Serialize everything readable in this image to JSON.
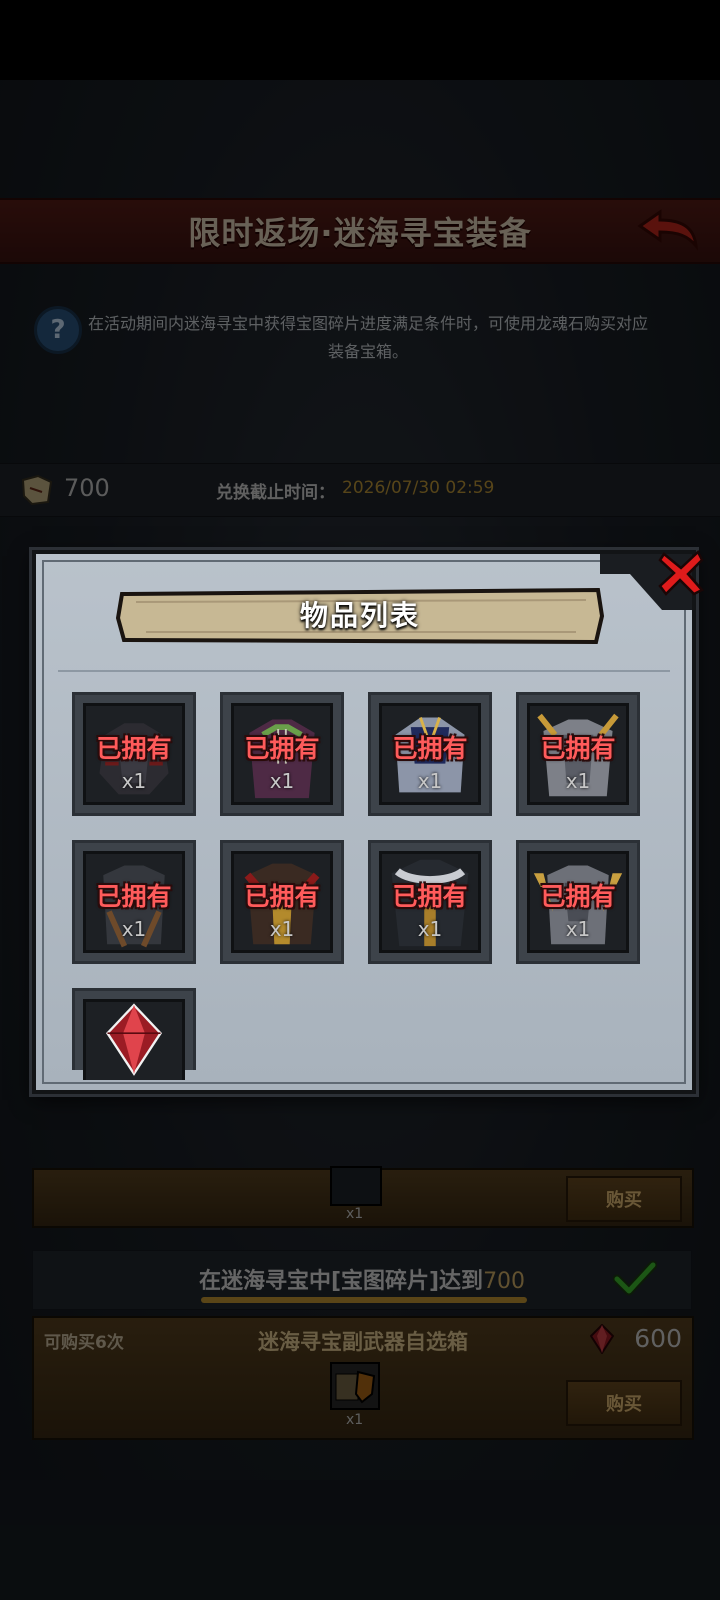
{
  "header": {
    "title": "限时返场·迷海寻宝装备"
  },
  "hint": {
    "text": "在活动期间内迷海寻宝中获得宝图碎片进度满足条件时，可使用龙魂石购买对应装备宝箱。"
  },
  "info": {
    "fragment_count": "700",
    "deadline_label": "兑换截止时间：",
    "deadline_value": "2026/07/30 02:59"
  },
  "rows": {
    "row1_qty": "x1",
    "row1_buy": "购买",
    "condition_prefix": "在迷海寻宝中[宝图碎片]达到",
    "condition_value": "700",
    "row2_limit": "可购买6次",
    "row2_title": "迷海寻宝副武器自选箱",
    "row2_price": "600",
    "row2_qty": "x1",
    "row2_buy": "购买"
  },
  "modal": {
    "title": "物品列表",
    "items": [
      {
        "status": "已拥有",
        "qty": "x1",
        "icon": "dark-armor-icon"
      },
      {
        "status": "已拥有",
        "qty": "x1",
        "icon": "purple-robe-icon"
      },
      {
        "status": "已拥有",
        "qty": "x1",
        "icon": "blue-armor-icon"
      },
      {
        "status": "已拥有",
        "qty": "x1",
        "icon": "gold-plate-armor-icon"
      },
      {
        "status": "已拥有",
        "qty": "x1",
        "icon": "leather-armor-icon"
      },
      {
        "status": "已拥有",
        "qty": "x1",
        "icon": "red-gold-armor-icon"
      },
      {
        "status": "已拥有",
        "qty": "x1",
        "icon": "fur-coat-icon"
      },
      {
        "status": "已拥有",
        "qty": "x1",
        "icon": "winged-armor-icon"
      },
      {
        "status": "",
        "qty": "",
        "icon": "red-gem-icon"
      }
    ]
  },
  "colors": {
    "owned_text": "#ff5b5b",
    "accent_gold": "#c29a39",
    "check_green": "#3fbf2f",
    "close_red": "#e01b1b"
  }
}
